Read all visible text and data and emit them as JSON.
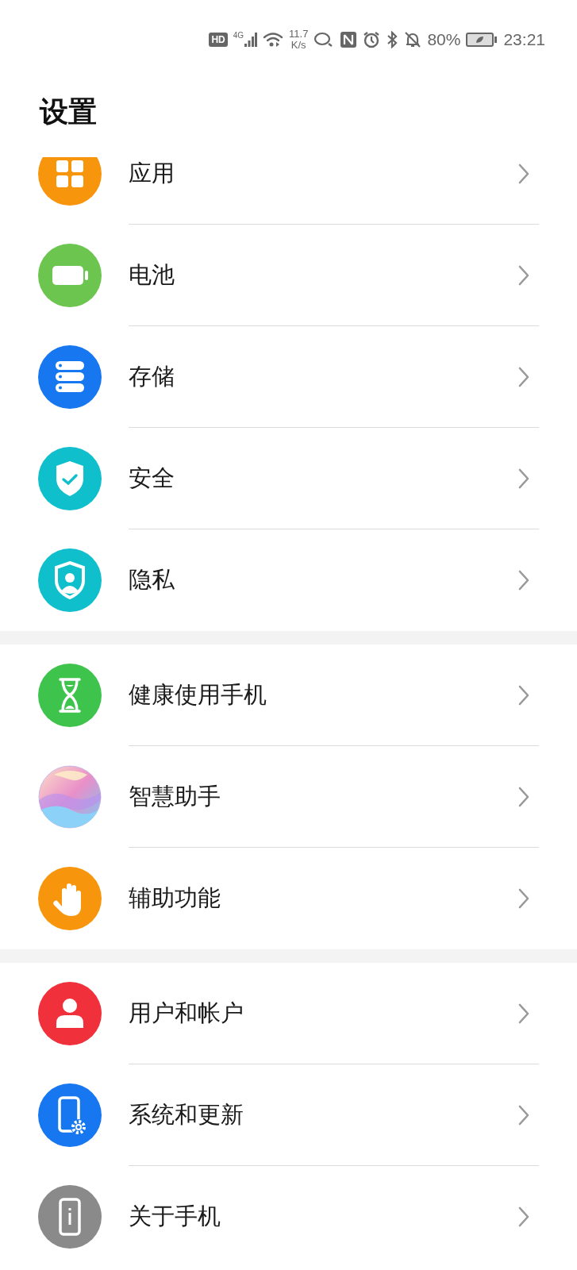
{
  "status_bar": {
    "hd": "HD",
    "network": "4G",
    "speed_value": "11.7",
    "speed_unit": "K/s",
    "battery": "80%",
    "time": "23:21"
  },
  "title": "设置",
  "groups": [
    {
      "items": [
        {
          "label": "应用",
          "kind": "apps"
        },
        {
          "label": "电池",
          "kind": "battery"
        },
        {
          "label": "存储",
          "kind": "storage"
        },
        {
          "label": "安全",
          "kind": "security"
        },
        {
          "label": "隐私",
          "kind": "privacy"
        }
      ]
    },
    {
      "items": [
        {
          "label": "健康使用手机",
          "kind": "hourglass"
        },
        {
          "label": "智慧助手",
          "kind": "assistant"
        },
        {
          "label": "辅助功能",
          "kind": "hand"
        }
      ]
    },
    {
      "items": [
        {
          "label": "用户和帐户",
          "kind": "user"
        },
        {
          "label": "系统和更新",
          "kind": "system"
        },
        {
          "label": "关于手机",
          "kind": "about"
        }
      ]
    }
  ]
}
